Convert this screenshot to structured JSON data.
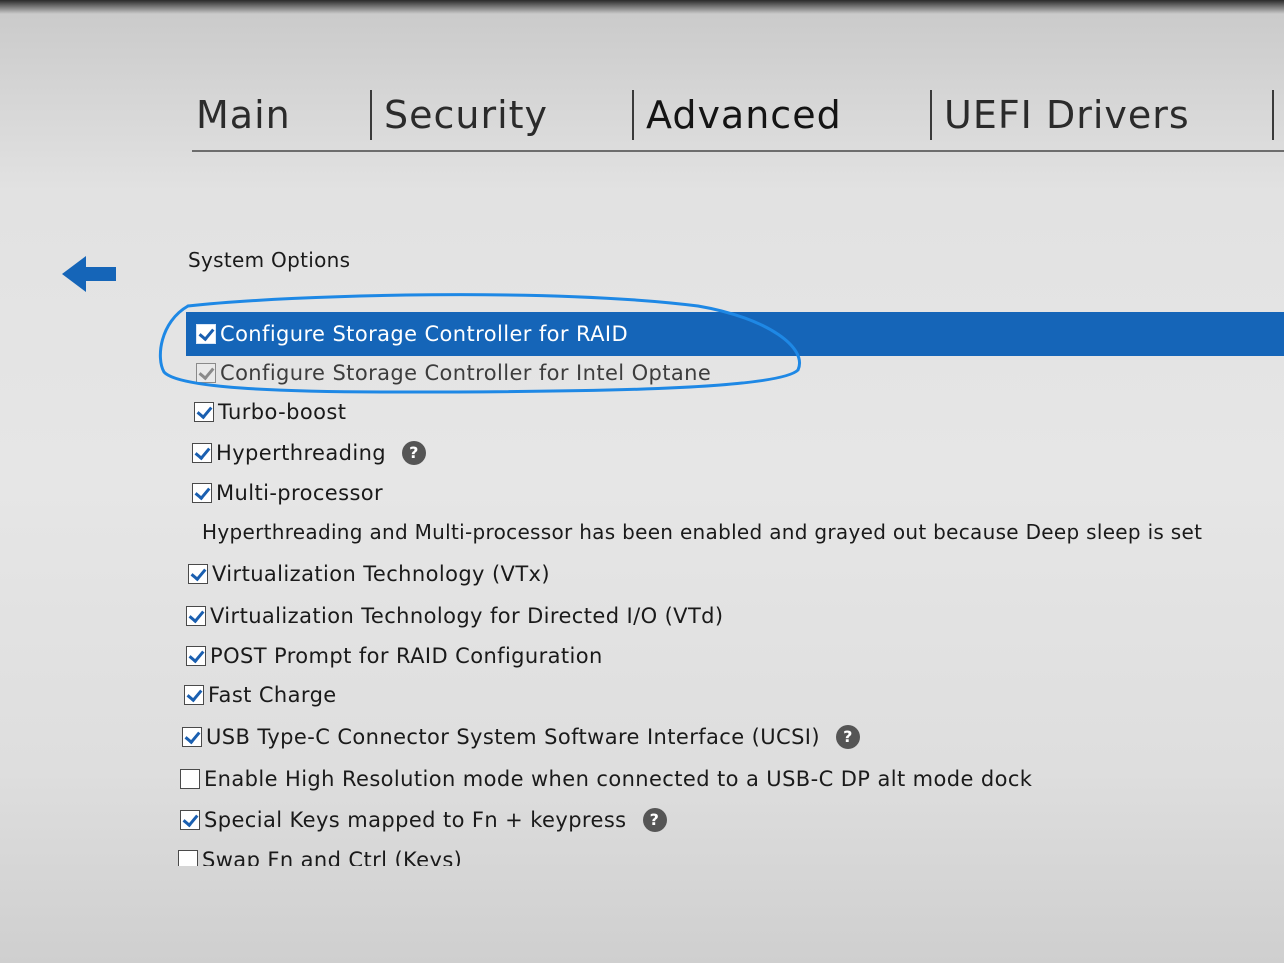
{
  "tabs": [
    {
      "label": "Main"
    },
    {
      "label": "Security"
    },
    {
      "label": "Advanced",
      "active": true
    },
    {
      "label": "UEFI Drivers"
    }
  ],
  "section": {
    "title": "System Options"
  },
  "options": [
    {
      "label": "Configure Storage Controller for RAID",
      "checked": true,
      "selected": true
    },
    {
      "label": "Configure Storage Controller for Intel Optane",
      "checked": true,
      "disabled": true
    },
    {
      "label": "Turbo-boost",
      "checked": true
    },
    {
      "label": "Hyperthreading",
      "checked": true,
      "help": true
    },
    {
      "label": "Multi-processor",
      "checked": true
    },
    {
      "label": "Virtualization Technology (VTx)",
      "checked": true
    },
    {
      "label": "Virtualization Technology for Directed I/O (VTd)",
      "checked": true
    },
    {
      "label": "POST Prompt for RAID Configuration",
      "checked": true
    },
    {
      "label": "Fast Charge",
      "checked": true
    },
    {
      "label": "USB Type-C Connector System Software Interface (UCSI)",
      "checked": true,
      "help": true
    },
    {
      "label": "Enable High Resolution mode when connected to a USB-C DP alt mode dock",
      "checked": false
    },
    {
      "label": "Special Keys mapped to Fn + keypress",
      "checked": true,
      "help": true
    },
    {
      "label": "Swap Fn and Ctrl (Keys)",
      "checked": false
    }
  ],
  "note": "Hyperthreading and Multi-processor has been enabled and grayed out because Deep sleep is set",
  "help_glyph": "?",
  "icons": {
    "back": "arrow-left-icon",
    "help": "help-circle-icon"
  },
  "colors": {
    "selection": "#1565b8",
    "annotation": "#1e88e5",
    "check": "#1a5fb0"
  }
}
